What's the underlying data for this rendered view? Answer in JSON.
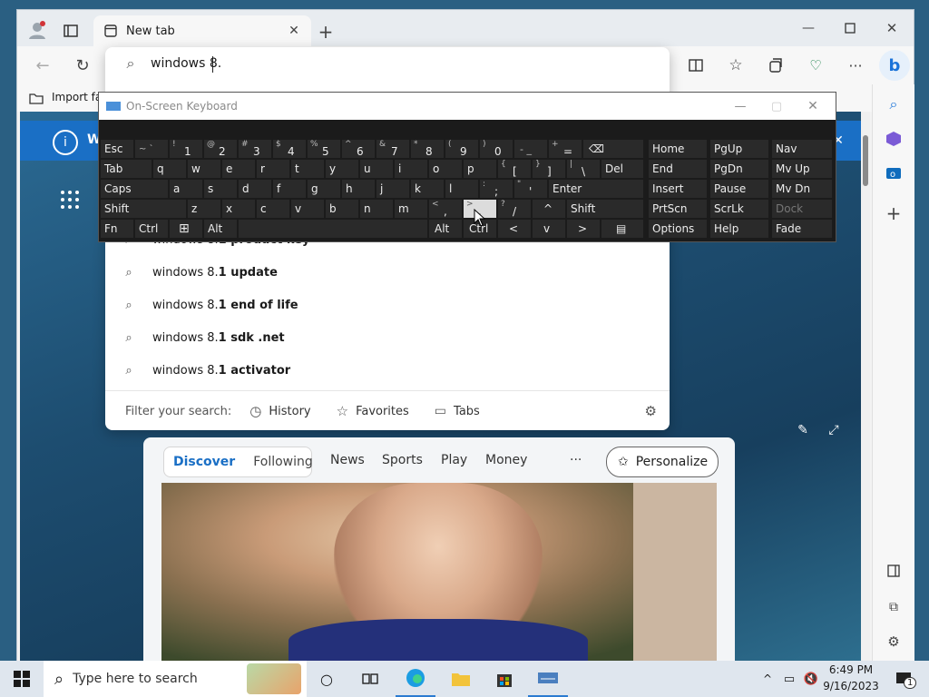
{
  "browser": {
    "tab_title": "New tab",
    "address_value": "windows 8.",
    "favorites_import": "Import fav",
    "banner_fragment": "W"
  },
  "suggestions": [
    {
      "prefix": "windows 8.",
      "bold": "1 product key"
    },
    {
      "prefix": "windows 8.",
      "bold": "1 update"
    },
    {
      "prefix": "windows 8.",
      "bold": "1 end of life"
    },
    {
      "prefix": "windows 8.",
      "bold": "1 sdk .net"
    },
    {
      "prefix": "windows 8.",
      "bold": "1 activator"
    }
  ],
  "filter": {
    "label": "Filter your search:",
    "history": "History",
    "favorites": "Favorites",
    "tabs": "Tabs"
  },
  "feed": {
    "tabs": [
      "Discover",
      "Following",
      "News",
      "Sports",
      "Play",
      "Money"
    ],
    "more": "···",
    "personalize": "Personalize"
  },
  "osk": {
    "title": "On-Screen Keyboard",
    "row1": {
      "esc": "Esc",
      "tilde": "~ `",
      "k1": "1",
      "k1s": "!",
      "k2": "2",
      "k2s": "@",
      "k3": "3",
      "k3s": "#",
      "k4": "4",
      "k4s": "$",
      "k5": "5",
      "k5s": "%",
      "k6": "6",
      "k6s": "^",
      "k7": "7",
      "k7s": "&",
      "k8": "8",
      "k8s": "*",
      "k9": "9",
      "k9s": "(",
      "k0": "0",
      "k0s": ")",
      "minus": "- _",
      "plus": "=",
      "pluss": "+",
      "bksp": "⌫"
    },
    "row2": {
      "tab": "Tab",
      "keys": [
        "q",
        "w",
        "e",
        "r",
        "t",
        "y",
        "u",
        "i",
        "o",
        "p"
      ],
      "lb": "[",
      "lbs": "{",
      "rb": "]",
      "rbs": "}",
      "bs": "\\",
      "bss": "|",
      "del": "Del"
    },
    "row3": {
      "caps": "Caps",
      "keys": [
        "a",
        "s",
        "d",
        "f",
        "g",
        "h",
        "j",
        "k",
        "l"
      ],
      "semi": ";",
      "semis": ":",
      "quote": "'",
      "quotes": "\"",
      "enter": "Enter"
    },
    "row4": {
      "shift": "Shift",
      "keys": [
        "z",
        "x",
        "c",
        "v",
        "b",
        "n",
        "m"
      ],
      "comma": ",",
      "commas": "<",
      "period": ".",
      "periods": ">",
      "slash": "/",
      "slashs": "?",
      "up": "^",
      "shift2": "Shift"
    },
    "row5": {
      "fn": "Fn",
      "ctrl": "Ctrl",
      "win": "⊞",
      "alt": "Alt",
      "alt2": "Alt",
      "ctrl2": "Ctrl",
      "left": "<",
      "down": "v",
      "right": ">",
      "menu": "▤"
    },
    "nav": [
      [
        "Home",
        "PgUp",
        "Nav"
      ],
      [
        "End",
        "PgDn",
        "Mv Up"
      ],
      [
        "Insert",
        "Pause",
        "Mv Dn"
      ],
      [
        "PrtScn",
        "ScrLk",
        "Dock"
      ],
      [
        "Options",
        "Help",
        "Fade"
      ]
    ]
  },
  "taskbar": {
    "search_placeholder": "Type here to search",
    "time": "6:49 PM",
    "date": "9/16/2023",
    "notif_count": "1"
  }
}
